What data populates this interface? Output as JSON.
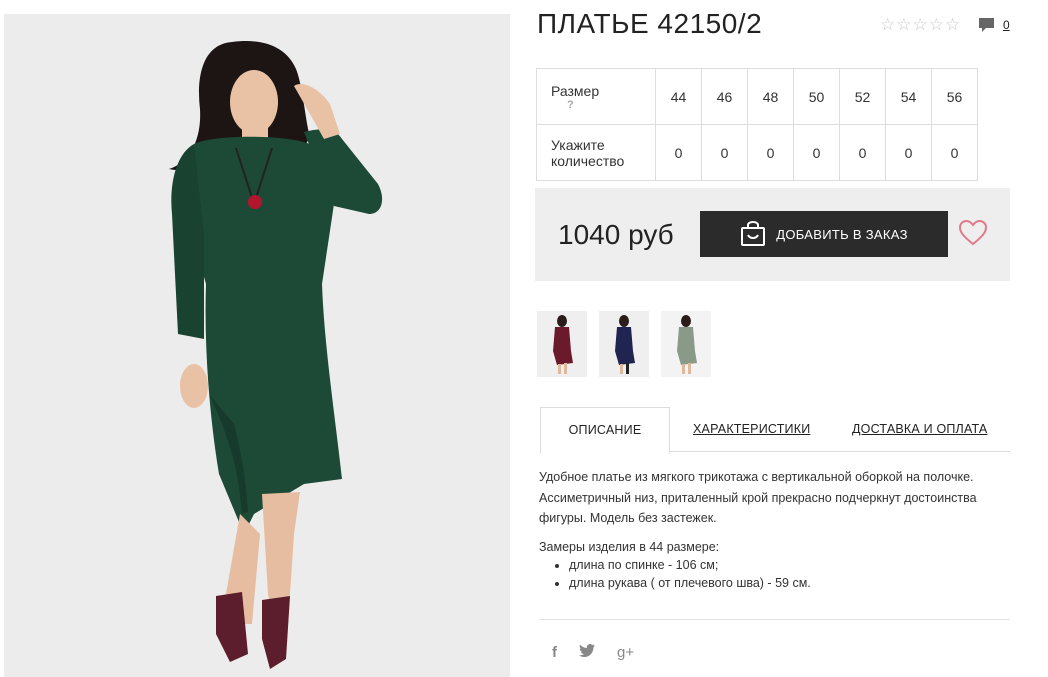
{
  "product": {
    "title": "ПЛАТЬЕ 42150/2",
    "rating_stars": 5,
    "comment_count": "0",
    "price": "1040 руб",
    "add_to_order_label": "ДОБАВИТЬ В ЗАКАЗ"
  },
  "size_table": {
    "size_label": "Размер",
    "help_mark": "?",
    "qty_label": "Укажите количество",
    "sizes": [
      "44",
      "46",
      "48",
      "50",
      "52",
      "54",
      "56"
    ],
    "quantities": [
      "0",
      "0",
      "0",
      "0",
      "0",
      "0",
      "0"
    ]
  },
  "thumbnails": [
    {
      "color": "#6a1a2a"
    },
    {
      "color": "#1f2550"
    },
    {
      "color": "#8a9a88"
    }
  ],
  "main_photo": {
    "dress_color": "#1d4a36",
    "shoe_color": "#5c1e2c",
    "background": "#ececec"
  },
  "tabs": [
    {
      "label": "ОПИСАНИЕ"
    },
    {
      "label": "ХАРАКТЕРИСТИКИ"
    },
    {
      "label": "ДОСТАВКА И ОПЛАТА"
    }
  ],
  "description": {
    "text": "Удобное платье из мягкого трикотажа с вертикальной оборкой на полочке. Ассиметричный низ, приталенный крой прекрасно подчеркнут достоинства фигуры. Модель без застежек.",
    "measures_title": "Замеры изделия в 44 размере:",
    "measures": [
      "длина по спинке - 106 см;",
      "длина рукава ( от плечевого шва) - 59 см."
    ]
  },
  "social": {
    "facebook": "f",
    "twitter": "twitter-icon",
    "google_plus": "g+"
  },
  "colors": {
    "button": "#2b2b2b",
    "heart": "#e07a8a",
    "star": "#c9c9c9"
  }
}
